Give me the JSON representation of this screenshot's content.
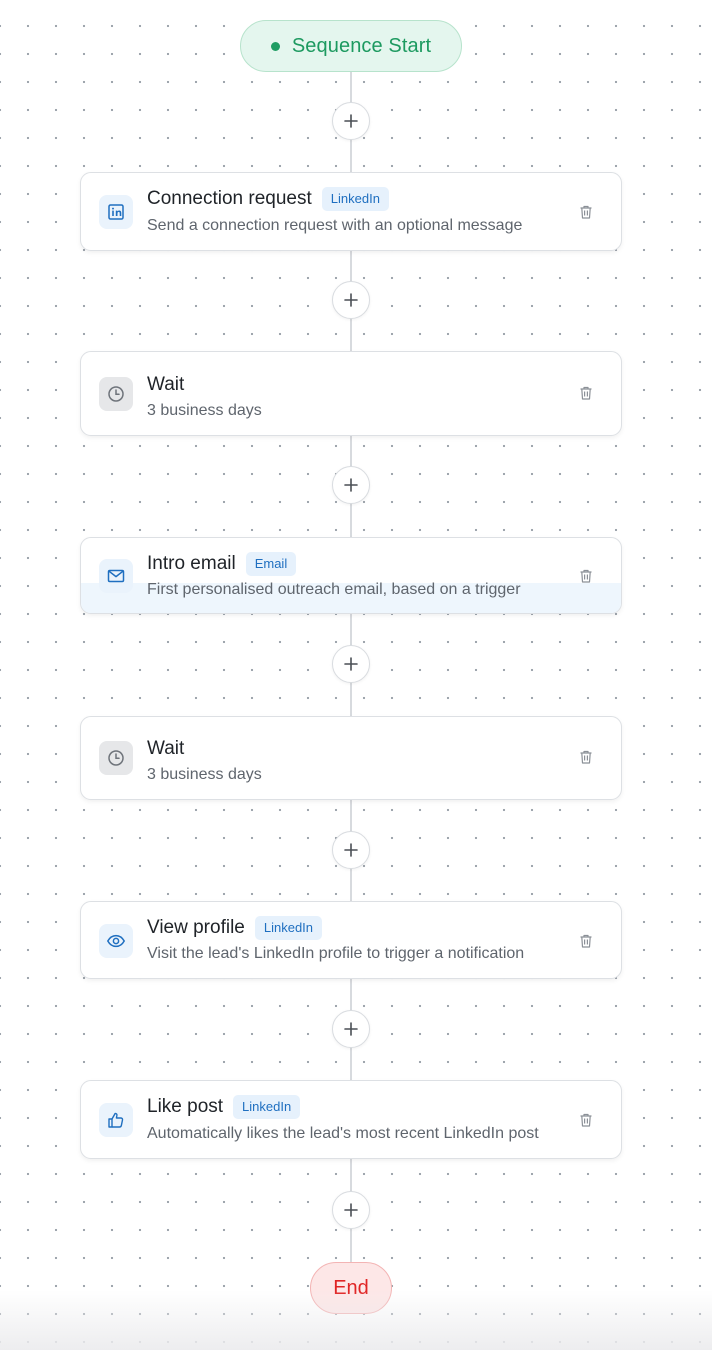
{
  "start": {
    "label": "Sequence Start"
  },
  "end": {
    "label": "End"
  },
  "add_step_icon": "plus-icon",
  "colors": {
    "start_green": "#1d9a60",
    "end_red": "#e02424",
    "badge_blue": "#1f6fc0"
  },
  "steps": [
    {
      "title": "Connection request",
      "channel": "LinkedIn",
      "subtitle": "Send a connection request with an optional message",
      "icon": "linkedin-icon"
    },
    {
      "title": "Wait",
      "channel": "",
      "subtitle": "3 business days",
      "icon": "clock-icon"
    },
    {
      "title": "Intro email",
      "channel": "Email",
      "subtitle": "First personalised outreach email, based on a trigger",
      "icon": "envelope-icon"
    },
    {
      "title": "Wait",
      "channel": "",
      "subtitle": "3 business days",
      "icon": "clock-icon"
    },
    {
      "title": "View profile",
      "channel": "LinkedIn",
      "subtitle": "Visit the lead's LinkedIn profile to trigger a notification",
      "icon": "eye-icon"
    },
    {
      "title": "Like post",
      "channel": "LinkedIn",
      "subtitle": "Automatically likes the lead's most recent LinkedIn post",
      "icon": "thumbs-up-icon"
    }
  ]
}
